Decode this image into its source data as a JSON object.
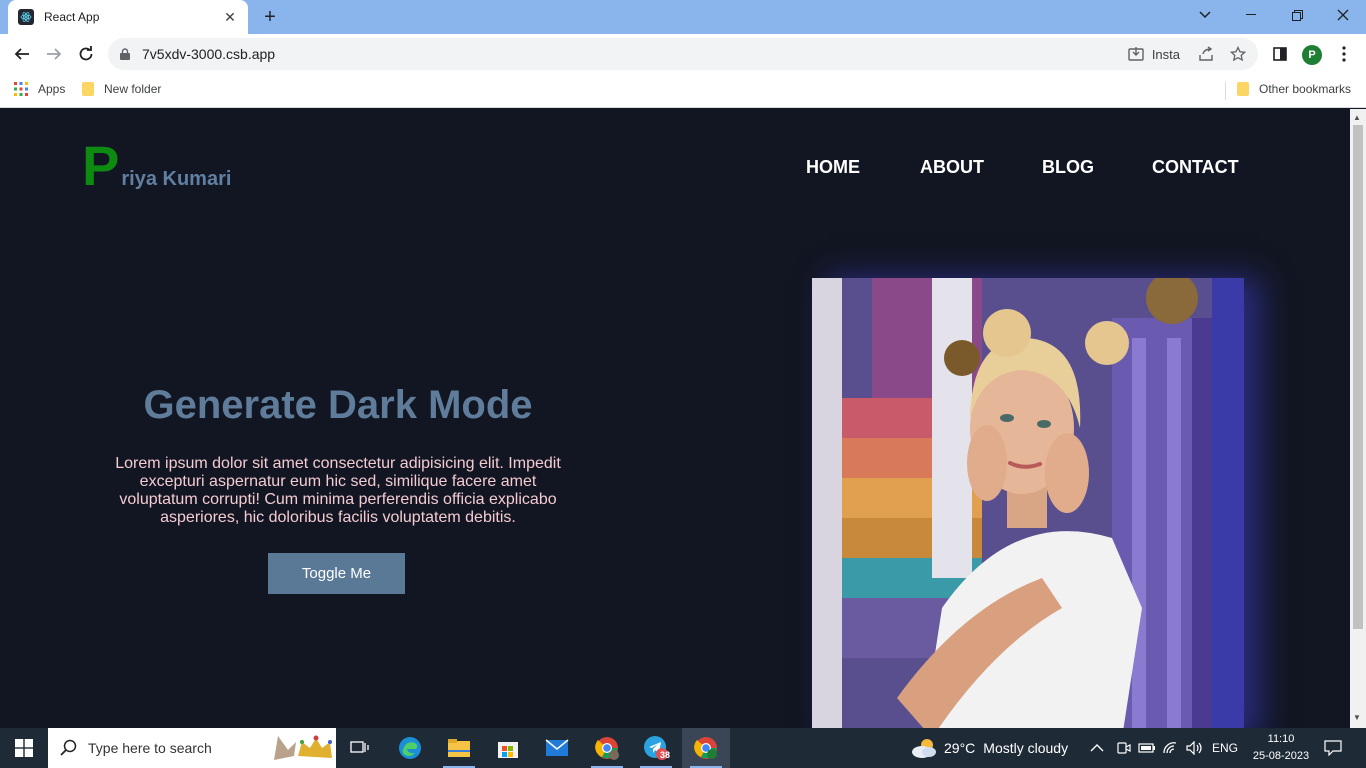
{
  "browser": {
    "tab_title": "React App",
    "url": "7v5xdv-3000.csb.app",
    "extension_label": "Insta",
    "profile_initial": "P",
    "bookmarks": {
      "apps": "Apps",
      "new_folder": "New folder",
      "other": "Other bookmarks"
    }
  },
  "site": {
    "logo_initial": "P",
    "logo_name": "riya Kumari",
    "nav": [
      "HOME",
      "ABOUT",
      "BLOG",
      "CONTACT"
    ],
    "hero_title": "Generate Dark Mode",
    "hero_text": "Lorem ipsum dolor sit amet consectetur adipisicing elit. Impedit excepturi aspernatur eum hic sed, similique facere amet voluptatum corrupti! Cum minima perferendis officia explicabo asperiores, hic doloribus facilis voluptatem debitis.",
    "toggle_label": "Toggle Me",
    "colors": {
      "background": "#121622",
      "logo_initial": "#0e8a11",
      "logo_name": "#617fa0",
      "title": "#5f7c9b",
      "text": "#f4cbd2",
      "button": "#5a7997"
    }
  },
  "taskbar": {
    "search_placeholder": "Type here to search",
    "weather_temp": "29°C",
    "weather_desc": "Mostly cloudy",
    "language": "ENG",
    "time": "11:10",
    "date": "25-08-2023",
    "telegram_badge": "38"
  }
}
